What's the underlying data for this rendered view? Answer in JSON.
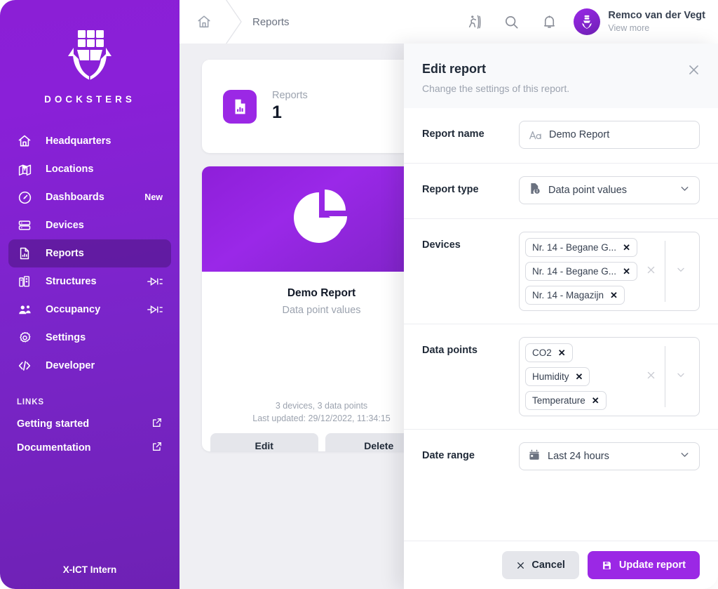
{
  "brand": {
    "name": "DOCKSTERS",
    "logo_icon": "ship-anchor-logo-icon",
    "footer": "X-ICT Intern"
  },
  "sidebar": {
    "items": [
      {
        "label": "Headquarters",
        "icon": "home-icon",
        "active": false,
        "badge": "",
        "right_icon": ""
      },
      {
        "label": "Locations",
        "icon": "map-pin-icon",
        "active": false,
        "badge": "",
        "right_icon": ""
      },
      {
        "label": "Dashboards",
        "icon": "gauge-icon",
        "active": false,
        "badge": "New",
        "right_icon": ""
      },
      {
        "label": "Devices",
        "icon": "server-icon",
        "active": false,
        "badge": "",
        "right_icon": ""
      },
      {
        "label": "Reports",
        "icon": "report-doc-icon",
        "active": true,
        "badge": "",
        "right_icon": ""
      },
      {
        "label": "Structures",
        "icon": "building-icon",
        "active": false,
        "badge": "",
        "right_icon": "plug-icon"
      },
      {
        "label": "Occupancy",
        "icon": "people-icon",
        "active": false,
        "badge": "",
        "right_icon": "plug-icon"
      },
      {
        "label": "Settings",
        "icon": "gear-icon",
        "active": false,
        "badge": "",
        "right_icon": ""
      },
      {
        "label": "Developer",
        "icon": "code-icon",
        "active": false,
        "badge": "",
        "right_icon": ""
      }
    ],
    "links_heading": "LINKS",
    "links": [
      {
        "label": "Getting started",
        "icon": "external-link-icon"
      },
      {
        "label": "Documentation",
        "icon": "external-link-icon"
      }
    ]
  },
  "header": {
    "home_icon": "home-icon",
    "breadcrumb": "Reports",
    "tools": [
      {
        "icon": "emergency-exit-icon"
      },
      {
        "icon": "search-icon"
      },
      {
        "icon": "bell-icon"
      }
    ],
    "user": {
      "name": "Remco van der Vegt",
      "subtitle": "View more",
      "avatar_icon": "anchor-avatar-icon"
    }
  },
  "content": {
    "stat": {
      "icon": "report-doc-icon",
      "label": "Reports",
      "value": "1"
    },
    "report_card": {
      "hero_icon": "pie-chart-icon",
      "title": "Demo Report",
      "subtitle": "Data point values",
      "meta_line1": "3 devices, 3 data points",
      "meta_line2": "Last updated: 29/12/2022, 11:34:15",
      "edit_label": "Edit",
      "delete_label": "Delete"
    }
  },
  "panel": {
    "title": "Edit report",
    "description": "Change the settings of this report.",
    "close_icon": "close-icon",
    "fields": {
      "report_name": {
        "label": "Report name",
        "icon": "text-format-icon",
        "value": "Demo Report",
        "placeholder": "Report name"
      },
      "report_type": {
        "label": "Report type",
        "icon": "data-doc-icon",
        "value": "Data point values",
        "chevron_icon": "chevron-down-icon"
      },
      "devices": {
        "label": "Devices",
        "chips": [
          "Nr. 14 - Begane G...",
          "Nr. 14 - Begane G...",
          "Nr. 14 - Magazijn"
        ],
        "clear_icon": "clear-icon",
        "chevron_icon": "chevron-down-icon"
      },
      "data_points": {
        "label": "Data points",
        "chips": [
          "CO2",
          "Humidity",
          "Temperature"
        ],
        "clear_icon": "clear-icon",
        "chevron_icon": "chevron-down-icon"
      },
      "date_range": {
        "label": "Date range",
        "icon": "calendar-icon",
        "value": "Last 24 hours",
        "chevron_icon": "chevron-down-icon"
      }
    },
    "footer": {
      "cancel_label": "Cancel",
      "cancel_icon": "close-icon",
      "submit_label": "Update report",
      "submit_icon": "save-icon"
    }
  },
  "colors": {
    "brand_purple": "#9B28E5",
    "sidebar_top": "#8B1FD6",
    "sidebar_bottom": "#6E21B4",
    "content_bg": "#EFEFF3",
    "panel_head_bg": "#F8F9FB"
  }
}
